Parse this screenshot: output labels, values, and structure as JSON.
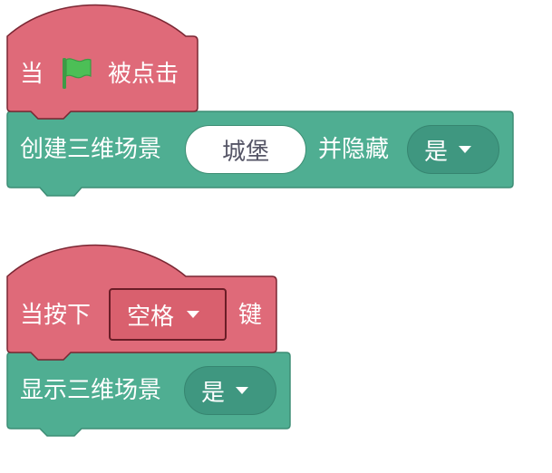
{
  "script1": {
    "hat": {
      "prefix": "当",
      "flag_icon": "green-flag-icon",
      "suffix": "被点击"
    },
    "command": {
      "label_before": "创建三维场景",
      "scene_name_value": "城堡",
      "label_middle": "并隐藏",
      "hide_option_value": "是"
    }
  },
  "script2": {
    "hat": {
      "prefix": "当按下",
      "key_option_value": "空格",
      "suffix": "键"
    },
    "command": {
      "label": "显示三维场景",
      "show_option_value": "是"
    }
  },
  "colors": {
    "event_block": "#df6a79",
    "event_block_border": "#7a2733",
    "looks_block": "#4fae92",
    "looks_block_border": "#3d8d75",
    "dropdown_fill": "#3f9780",
    "flag_green": "#4cbf56"
  }
}
